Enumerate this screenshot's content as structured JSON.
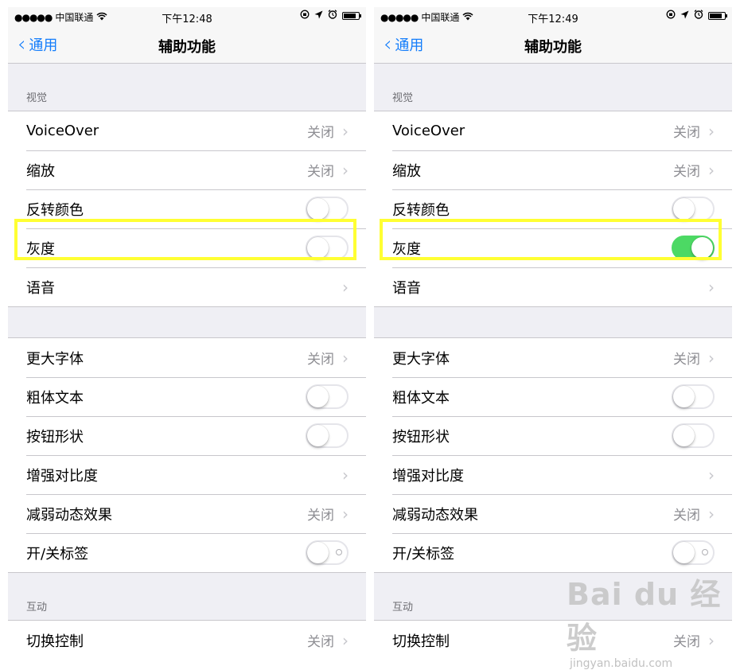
{
  "screens": [
    {
      "status_bar": {
        "signal": "●●●●●",
        "carrier": "中国联通",
        "wifi_icon": "wifi",
        "time": "下午12:48",
        "right_icons": [
          "orientation-lock-icon",
          "location-icon",
          "alarm-icon",
          "battery-icon"
        ]
      },
      "nav": {
        "back_label": "通用",
        "title": "辅助功能"
      },
      "sections": [
        {
          "header": "视觉",
          "rows": [
            {
              "label": "VoiceOver",
              "type": "detail",
              "detail": "关闭"
            },
            {
              "label": "缩放",
              "type": "detail",
              "detail": "关闭"
            },
            {
              "label": "反转颜色",
              "type": "toggle",
              "on": false
            },
            {
              "label": "灰度",
              "type": "toggle",
              "on": false
            },
            {
              "label": "语音",
              "type": "chevron"
            }
          ]
        },
        {
          "header": "",
          "rows": [
            {
              "label": "更大字体",
              "type": "detail",
              "detail": "关闭"
            },
            {
              "label": "粗体文本",
              "type": "toggle",
              "on": false
            },
            {
              "label": "按钮形状",
              "type": "toggle",
              "on": false
            },
            {
              "label": "增强对比度",
              "type": "chevron"
            },
            {
              "label": "减弱动态效果",
              "type": "detail",
              "detail": "关闭"
            },
            {
              "label": "开/关标签",
              "type": "toggle",
              "on": false,
              "onoff_label": true
            }
          ]
        },
        {
          "header": "互动",
          "rows": [
            {
              "label": "切换控制",
              "type": "detail",
              "detail": "关闭"
            }
          ]
        }
      ]
    },
    {
      "status_bar": {
        "signal": "●●●●●",
        "carrier": "中国联通",
        "wifi_icon": "wifi",
        "time": "下午12:49",
        "right_icons": [
          "orientation-lock-icon",
          "location-icon",
          "alarm-icon",
          "battery-icon"
        ]
      },
      "nav": {
        "back_label": "通用",
        "title": "辅助功能"
      },
      "sections": [
        {
          "header": "视觉",
          "rows": [
            {
              "label": "VoiceOver",
              "type": "detail",
              "detail": "关闭"
            },
            {
              "label": "缩放",
              "type": "detail",
              "detail": "关闭"
            },
            {
              "label": "反转颜色",
              "type": "toggle",
              "on": false
            },
            {
              "label": "灰度",
              "type": "toggle",
              "on": true
            },
            {
              "label": "语音",
              "type": "chevron"
            }
          ]
        },
        {
          "header": "",
          "rows": [
            {
              "label": "更大字体",
              "type": "detail",
              "detail": "关闭"
            },
            {
              "label": "粗体文本",
              "type": "toggle",
              "on": false
            },
            {
              "label": "按钮形状",
              "type": "toggle",
              "on": false
            },
            {
              "label": "增强对比度",
              "type": "chevron"
            },
            {
              "label": "减弱动态效果",
              "type": "detail",
              "detail": "关闭"
            },
            {
              "label": "开/关标签",
              "type": "toggle",
              "on": false,
              "onoff_label": true
            }
          ]
        },
        {
          "header": "互动",
          "rows": [
            {
              "label": "切换控制",
              "type": "detail",
              "detail": "关闭"
            }
          ]
        }
      ]
    }
  ],
  "highlight_color": "#ffff33",
  "accent_color": "#157efb",
  "toggle_on_color": "#4cd964",
  "watermark": {
    "main": "Bai du 经验",
    "sub": "jingyan.baidu.com"
  }
}
